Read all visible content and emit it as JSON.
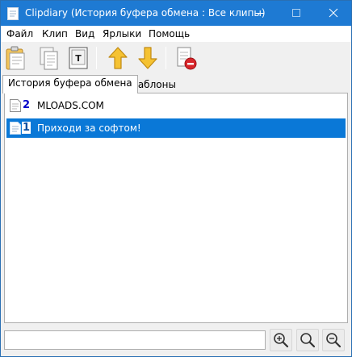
{
  "window": {
    "title": "Clipdiary (История буфера обмена : Все клипы)",
    "controls": {
      "minimize": "minimize-icon",
      "maximize": "maximize-icon",
      "close": "close-icon"
    }
  },
  "menu": {
    "items": [
      "Файл",
      "Клип",
      "Вид",
      "Ярлыки",
      "Помощь"
    ]
  },
  "toolbar": {
    "buttons": [
      "paste-icon",
      "copy-icon",
      "plain-text-icon",
      "move-up-icon",
      "move-down-icon",
      "delete-clip-icon"
    ],
    "plain_text_glyph": "T"
  },
  "tabs": [
    {
      "label": "История буфера обмена",
      "active": true
    },
    {
      "label": "Шаблоны",
      "active": false
    }
  ],
  "clips": [
    {
      "number": "2",
      "text": "MLOADS.COM",
      "selected": false
    },
    {
      "number": "1",
      "text": "Приходи за софтом!",
      "selected": true
    }
  ],
  "search": {
    "value": "",
    "placeholder": ""
  },
  "zoom_buttons": [
    "zoom-in-icon",
    "zoom-reset-icon",
    "zoom-out-icon"
  ],
  "colors": {
    "titlebar": "#1e7ad3",
    "selection": "#0a78d7",
    "clip_number": "#0000c8",
    "arrow_yellow": "#f5c232"
  }
}
